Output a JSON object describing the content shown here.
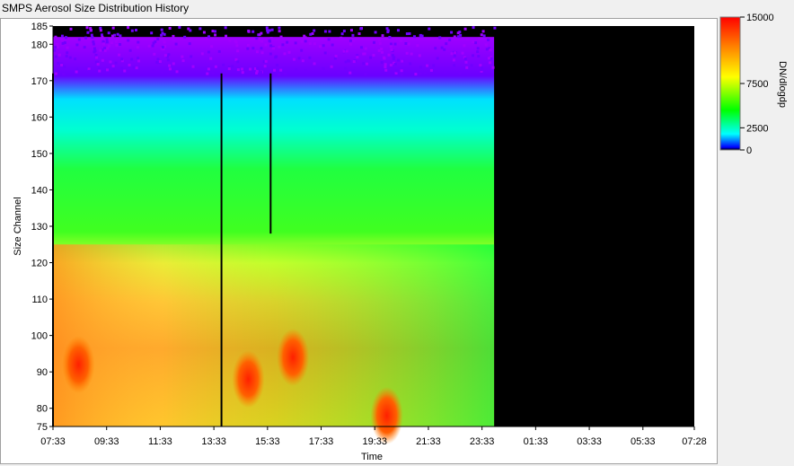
{
  "window_title": "SMPS Aerosol Size Distribution History",
  "colors": {
    "plot_background": "#000000",
    "empty_region": "#000000"
  },
  "chart_data": {
    "type": "heatmap",
    "title": "SMPS Aerosol Size Distribution History",
    "xlabel": "Time",
    "ylabel": "Size Channel",
    "colorbar_label": "DN/dlogdp",
    "x_tick_labels": [
      "07:33",
      "09:33",
      "11:33",
      "13:33",
      "15:33",
      "17:33",
      "19:33",
      "21:33",
      "23:33",
      "01:33",
      "03:33",
      "05:33",
      "07:28"
    ],
    "y_ticks": [
      75,
      80,
      90,
      100,
      110,
      120,
      130,
      140,
      150,
      160,
      170,
      180,
      185
    ],
    "ylim": [
      75,
      185
    ],
    "colorbar_ticks": [
      0,
      2500,
      7500,
      15000
    ],
    "colorbar_range": [
      0,
      15000
    ],
    "colormap": [
      "#000000",
      "#0000ff",
      "#00ffff",
      "#00ff00",
      "#ffff00",
      "#ff8000",
      "#ff0000"
    ],
    "data_end_time": "00:00",
    "data_description_bands": [
      {
        "channels": [
          175,
          185
        ],
        "level": "purple sparse"
      },
      {
        "channels": [
          160,
          170
        ],
        "value": 2000
      },
      {
        "channels": [
          130,
          150
        ],
        "value": 4500
      },
      {
        "channels": [
          110,
          125
        ],
        "value": 7500
      },
      {
        "channels": [
          75,
          105
        ],
        "value": 10000
      }
    ],
    "hotspots": [
      {
        "time": "08:30",
        "channel": 92,
        "value": 12500
      },
      {
        "time": "14:50",
        "channel": 88,
        "value": 13000
      },
      {
        "time": "16:30",
        "channel": 94,
        "value": 12500
      },
      {
        "time": "20:00",
        "channel": 78,
        "value": 13500
      }
    ],
    "vertical_gaps": [
      "07:33",
      "13:50",
      "15:40"
    ]
  }
}
